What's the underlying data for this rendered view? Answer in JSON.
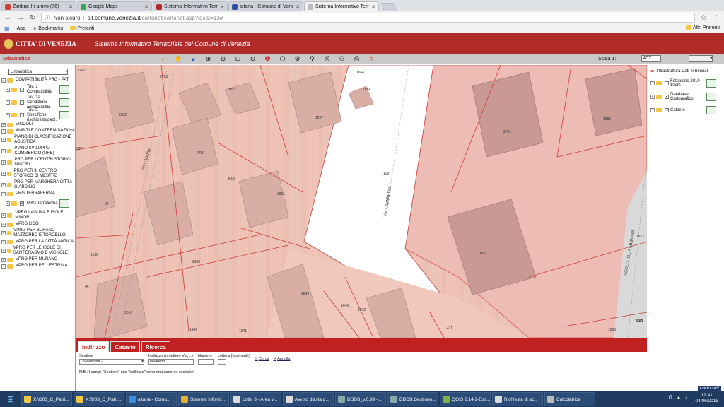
{
  "browser": {
    "tabs": [
      {
        "label": "Zimbra: In arrivo (76)",
        "color": "#d04030"
      },
      {
        "label": "Google Maps",
        "color": "#34a853"
      },
      {
        "label": "Sistema Informativo Terr",
        "color": "#b22b2b"
      },
      {
        "label": "altana - Comune di Vene",
        "color": "#3050a0"
      },
      {
        "label": "Sistema Informativo Terr",
        "color": "#888888",
        "active": true
      }
    ],
    "not_secure": "Non sicuro",
    "url_host": "sit.comune.venezia.it",
    "url_path": "/cartanet/cartanet.asp?idcat=13#",
    "bookmarks": [
      "App",
      "Bookmarks",
      "Preferiti"
    ],
    "other_bookmarks": "Altri Preferiti"
  },
  "app": {
    "city": "CITTA' DI VENEZIA",
    "system_title": "Sistema Informativo Territoriale del Comune di Venezia",
    "section": "Urbanistica",
    "scale_label": "Scala 1:",
    "scale_value": "407"
  },
  "left_panel": {
    "selected_group": "Urbanistica",
    "group1": "COMPATIBILITÀ PRG - PAT",
    "tav1": "Tav. 1 Compatibilità",
    "tav1a": "Tav. 1a Condizioni compatibilità",
    "tav2": "Tav. 2 Specifiche rischio idrogeol.",
    "g_vincoli": "VINCOLI",
    "g_ambiti": "AMBITI E CONTERMINAZIONI",
    "g_acustica": "PIANO DI CLASSIFICAZIONE ACUSTICA",
    "g_commercio": "PIANO SVILUPPO COMMERCIO (URB)",
    "g_centri_minori": "PRG PER I CENTRI STORICI MINORI",
    "g_centro_storico": "PRG PER IL CENTRO STORICO DI MESTRE",
    "g_marghera": "PRG PER MARGHERA CITTÀ GIARDINO",
    "g_terraferma": "PRG TERRAFERMA",
    "prg_terraferma": "PRG Terraferma",
    "g_laguna": "VPRG LAGUNA E ISOLE MINORI",
    "g_lido": "VPRG LIDO",
    "g_burano": "VPRG PER BURANO MAZZORBO E TORCELLO",
    "g_citta_antica": "VPRG PER LA CITTÀ ANTICA",
    "g_isole": "VPRG PER LE ISOLE DI SANT'ERASMO E VIGNOLE",
    "g_murano": "VPRG PER MURANO",
    "g_pellestrina": "VPRG PER PELLESTRINA"
  },
  "right_panel": {
    "title": "Infrastruttura Dati Territoriali",
    "layers": [
      "Fotopiano 2010 10cm",
      "Database Cartografico",
      "Catasto"
    ],
    "brand": "carto net"
  },
  "map": {
    "street_1": "VIA CADORE",
    "street_2": "VIA LAVAREDO",
    "street_3": "VICOLO VAL SABBIONA",
    "labels": [
      "1142",
      "2793",
      "1664",
      "1654",
      "2602",
      "2701",
      "1681",
      "2780",
      "2801",
      "1237",
      "1827",
      "B13",
      "109",
      "2960",
      "1156",
      "1640",
      "1572",
      "1649",
      "411",
      "1641",
      "1946",
      "1855",
      "1680",
      "B13",
      "2016",
      "1612",
      "1660",
      "95",
      "94",
      "597"
    ]
  },
  "search": {
    "tabs": [
      "Indirizzo",
      "Catasto",
      "Ricerca"
    ],
    "sestiere_label": "Sestiere",
    "sestiere_value": "- Seleziona -",
    "indirizzo_label": "Indirizzo (omettere Via,...)",
    "indirizzo_value": "lavaredo",
    "numero_label": "Numero",
    "lettera_label": "Lettera (opzionale)",
    "cerca": "Cerca",
    "annulla": "Annulla",
    "note": "N.B.: I campi \"Sestiere\" and \"Indirizzo\" sono mutuamente esclusivi"
  },
  "taskbar": {
    "items": [
      "X:\\D03_C_Patri...",
      "X:\\D03_C_Patri...",
      "altana - Comu...",
      "Sistema Inform...",
      "Lotto 3 - Area v...",
      "Avviso d'asta p...",
      "DDDB_v.0.99 -...",
      "DDDB.Gestione...",
      "QGIS 2.14.2-Ess...",
      "Richiesta di ac...",
      "Calcolatrice"
    ],
    "lang": "IT",
    "time": "12:41",
    "date": "04/06/2018"
  }
}
